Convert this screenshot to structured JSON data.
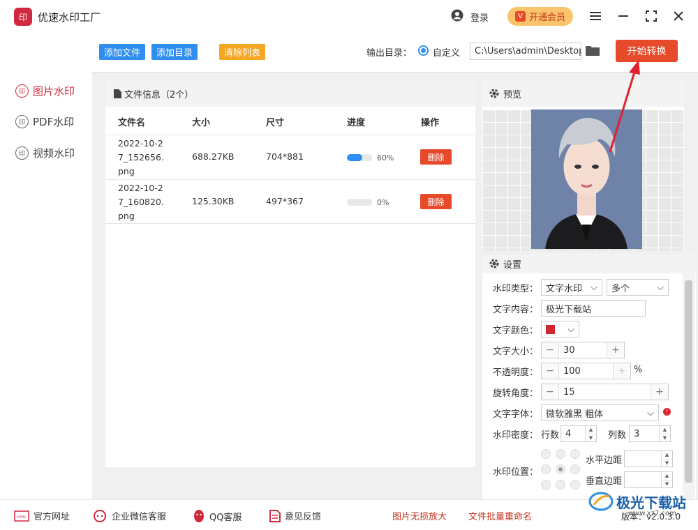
{
  "app": {
    "logo_text": "印",
    "title": "优速水印工厂"
  },
  "header": {
    "login": "登录",
    "vip_label": "开通会员",
    "vip_icon": "V"
  },
  "sidebar": {
    "items": [
      {
        "label": "图片水印",
        "icon": "印",
        "active": true
      },
      {
        "label": "PDF水印",
        "icon": "印",
        "active": false
      },
      {
        "label": "视频水印",
        "icon": "印",
        "active": false
      }
    ]
  },
  "toolbar": {
    "add_file": "添加文件",
    "add_dir": "添加目录",
    "clear_list": "清除列表",
    "output_label": "输出目录：",
    "custom": "自定义",
    "path": "C:\\Users\\admin\\Desktop",
    "start": "开始转换"
  },
  "files": {
    "header": "文件信息（2个）",
    "columns": [
      "文件名",
      "大小",
      "尺寸",
      "进度",
      "操作"
    ],
    "rows": [
      {
        "name_lines": [
          "2022-10-2",
          "7_152656.",
          "png"
        ],
        "size": "688.27KB",
        "dim": "704*881",
        "progress": 0.6,
        "pct": "60%",
        "action": "删除"
      },
      {
        "name_lines": [
          "2022-10-2",
          "7_160820.",
          "png"
        ],
        "size": "125.30KB",
        "dim": "497*367",
        "progress": 0,
        "pct": "0%",
        "action": "删除"
      }
    ]
  },
  "preview": {
    "title": "预览"
  },
  "settings": {
    "title": "设置",
    "type_label": "水印类型：",
    "type_value": "文字水印",
    "count_value": "多个",
    "content_label": "文字内容：",
    "content_value": "极光下载站",
    "color_label": "文字颜色：",
    "color": "#d0262e",
    "size_label": "文字大小：",
    "size_value": "30",
    "opacity_label": "不透明度：",
    "opacity_value": "100",
    "opacity_unit": "%",
    "angle_label": "旋转角度：",
    "angle_value": "15",
    "font_label": "文字字体：",
    "font_value": "微软雅黑 粗体",
    "density_label": "水印密度：",
    "rows_label": "行数",
    "rows_value": "4",
    "cols_label": "列数",
    "cols_value": "3",
    "position_label": "水印位置：",
    "h_margin_label": "水平边距",
    "v_margin_label": "垂直边距"
  },
  "footer": {
    "website": "官方网址",
    "wechat": "企业微信客服",
    "qq": "QQ客服",
    "feedback": "意见反馈",
    "upscale": "图片无损放大",
    "rename": "文件批量重命名",
    "version": "版本：v2.0.3.0"
  },
  "watermark": {
    "text": "极光下载站",
    "sub": "www.xz7.com"
  }
}
